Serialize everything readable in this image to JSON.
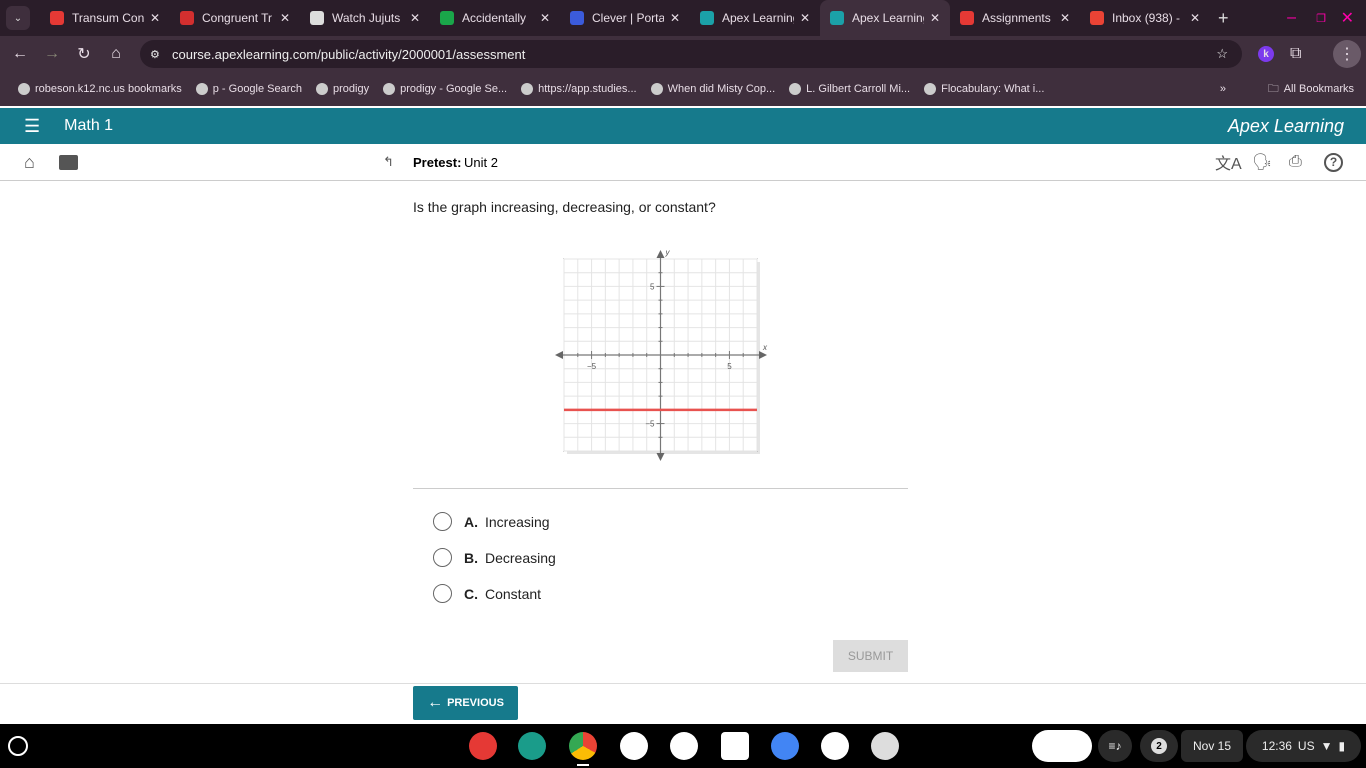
{
  "browser": {
    "tabs": [
      {
        "title": "Transum Con",
        "color": "#e53935"
      },
      {
        "title": "Congruent Tr",
        "color": "#d32f2f"
      },
      {
        "title": "Watch Jujuts",
        "color": "#dddddd"
      },
      {
        "title": "Accidentally",
        "color": "#1aa64a"
      },
      {
        "title": "Clever | Porta",
        "color": "#3b5bdb"
      },
      {
        "title": "Apex Learning",
        "color": "#1ba1a8"
      },
      {
        "title": "Apex Learning",
        "color": "#1ba1a8",
        "active": true
      },
      {
        "title": "Assignments",
        "color": "#e53935"
      },
      {
        "title": "Inbox (938) -",
        "color": "#ea4335"
      }
    ],
    "new_tab": "+",
    "url": "course.apexlearning.com/public/activity/2000001/assessment",
    "profile_initial": "k",
    "bookmarks": [
      "robeson.k12.nc.us bookmarks",
      "p - Google Search",
      "prodigy",
      "prodigy - Google Se...",
      "https://app.studies...",
      "When did Misty Cop...",
      "L. Gilbert Carroll Mi...",
      "Flocabulary: What i..."
    ],
    "more": "»",
    "all_bookmarks": "All Bookmarks"
  },
  "apex": {
    "course": "Math 1",
    "brand": "Apex Learning",
    "brand_color": "#167a8c"
  },
  "subheader": {
    "label": "Pretest:",
    "unit": "Unit 2"
  },
  "question": {
    "text": "Is the graph increasing, decreasing, or constant?",
    "choices": [
      {
        "letter": "A.",
        "text": "Increasing"
      },
      {
        "letter": "B.",
        "text": "Decreasing"
      },
      {
        "letter": "C.",
        "text": "Constant"
      }
    ],
    "submit": "SUBMIT",
    "previous": "PREVIOUS"
  },
  "chart_data": {
    "type": "line",
    "xlabel": "x",
    "ylabel": "y",
    "xlim": [
      -7,
      7
    ],
    "ylim": [
      -7,
      7
    ],
    "xticks_labeled": [
      -5,
      5
    ],
    "yticks_labeled": [
      5,
      -5
    ],
    "tick_labels": {
      "x": [
        "−5",
        "5"
      ],
      "y": [
        "5",
        "−5"
      ]
    },
    "grid": true,
    "series": [
      {
        "points": [
          [
            -7,
            -4
          ],
          [
            7,
            -4
          ]
        ],
        "color": "#e8524f"
      }
    ]
  },
  "taskbar": {
    "notifications": "2",
    "date": "Nov 15",
    "time": "12:36",
    "locale": "US"
  }
}
